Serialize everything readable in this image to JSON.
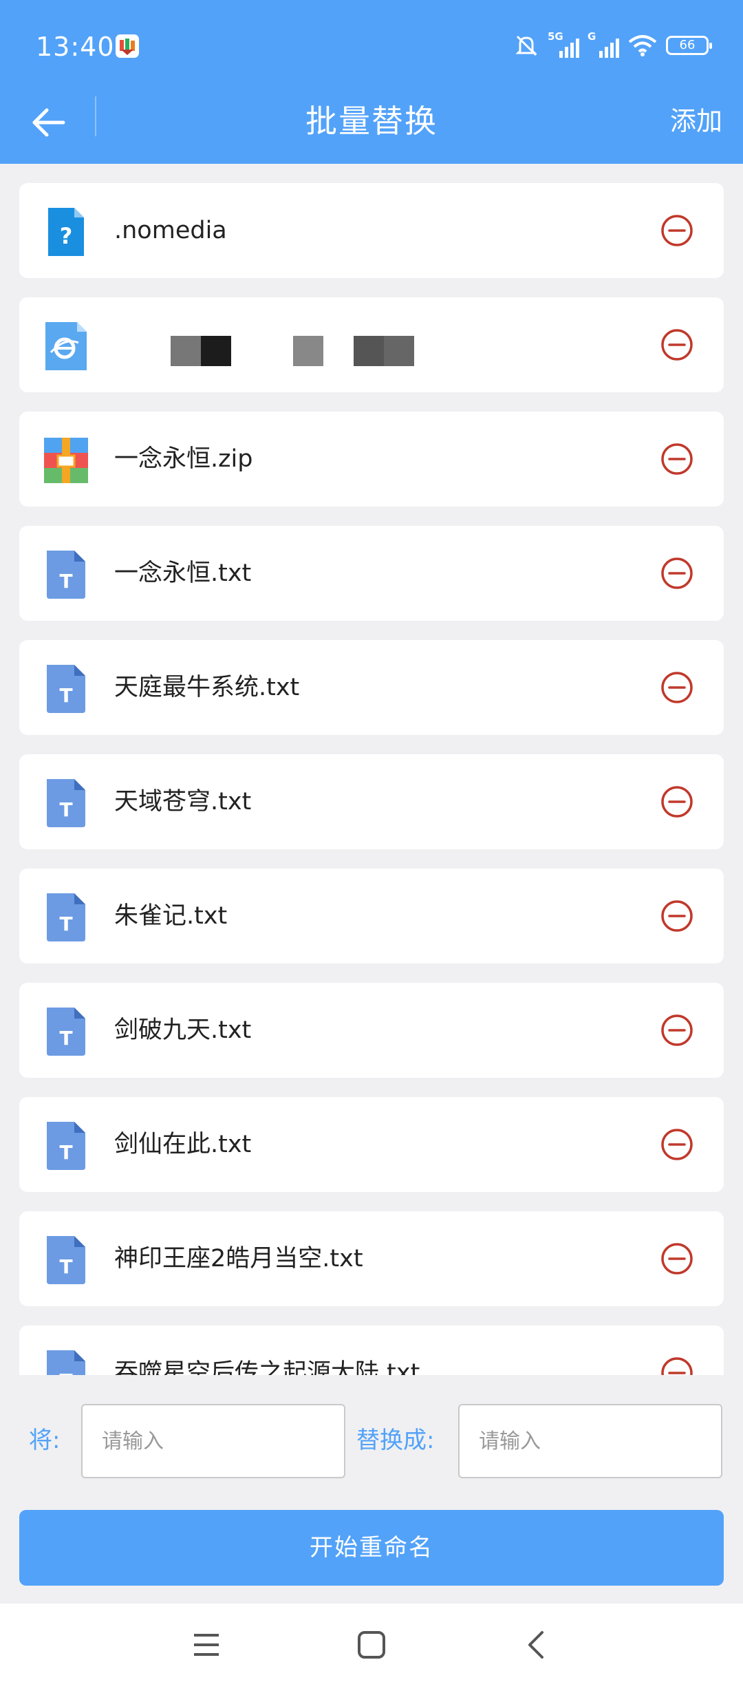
{
  "status_bar": {
    "time": "13:40",
    "network_1": "5G",
    "network_2": "G",
    "battery": "66"
  },
  "nav": {
    "title": "批量替换",
    "add_label": "添加"
  },
  "files": [
    {
      "name": ".nomedia",
      "icon": "unknown-file-icon"
    },
    {
      "name": "",
      "icon": "html-file-icon",
      "redacted": true
    },
    {
      "name": "一念永恒.zip",
      "icon": "zip-file-icon"
    },
    {
      "name": "一念永恒.txt",
      "icon": "txt-file-icon"
    },
    {
      "name": "天庭最牛系统.txt",
      "icon": "txt-file-icon"
    },
    {
      "name": "天域苍穹.txt",
      "icon": "txt-file-icon"
    },
    {
      "name": "朱雀记.txt",
      "icon": "txt-file-icon"
    },
    {
      "name": "剑破九天.txt",
      "icon": "txt-file-icon"
    },
    {
      "name": "剑仙在此.txt",
      "icon": "txt-file-icon"
    },
    {
      "name": "神印王座2皓月当空.txt",
      "icon": "txt-file-icon"
    },
    {
      "name": "吞噬星空后传之起源大陆.txt",
      "icon": "txt-file-icon"
    }
  ],
  "replace": {
    "from_label": "将:",
    "from_placeholder": "请输入",
    "from_value": "",
    "to_label": "替换成:",
    "to_placeholder": "请输入",
    "to_value": ""
  },
  "start_button": "开始重命名",
  "colors": {
    "accent": "#52a2f9",
    "remove": "#c0392b",
    "txt_icon": "#6c9be3"
  }
}
